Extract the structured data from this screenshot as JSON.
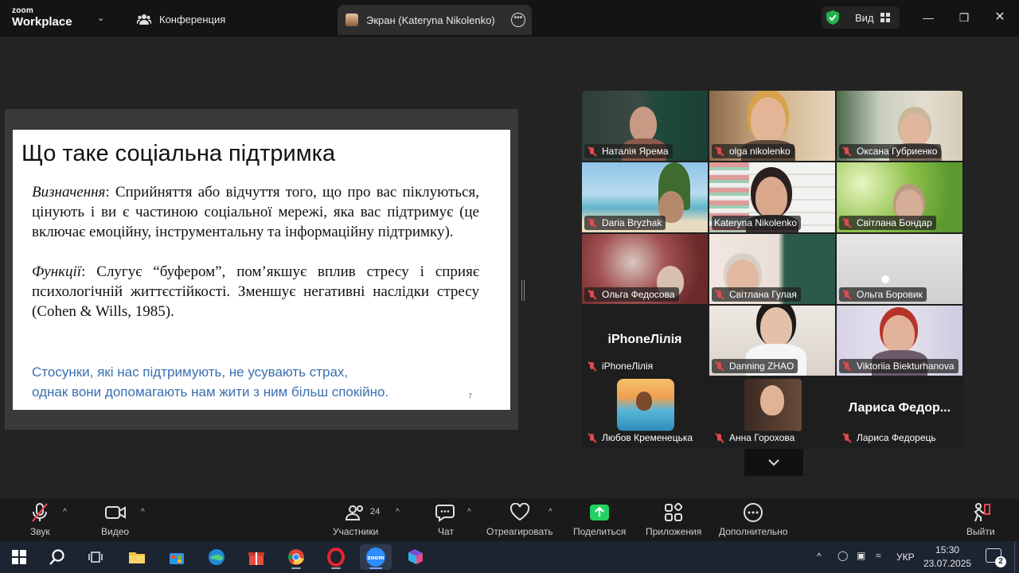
{
  "titlebar": {
    "logo_line1": "zoom",
    "logo_line2": "Workplace",
    "conference_tab": "Конференция",
    "screen_tab": "Экран (Kateryna Nikolenko)",
    "view_label": "Вид"
  },
  "slide": {
    "title": "Що таке соціальна підтримка",
    "definition_term": "Визначення",
    "definition_text": ": Сприйняття або відчуття того, що про вас піклуються, цінують і ви є частиною соціальної мережі, яка вас підтримує (це включає емоційну, інструментальну та інформаційну підтримку).",
    "functions_term": "Функції",
    "functions_text": ": Слугує “буфером”, пом’якшує вплив стресу і сприяє психологічній життєстійкості. Зменшує негативні наслідки стресу (Cohen & Wills, 1985).",
    "quote_line1": "Стосунки, які нас підтримують, не усувають страх,",
    "quote_line2": "однак вони допомагають нам жити з ним більш спокійно.",
    "page_number": "7"
  },
  "gallery": {
    "tiles": [
      {
        "name": "Наталія Ярема",
        "muted": true
      },
      {
        "name": "olga nikolenko",
        "muted": true
      },
      {
        "name": "Оксана Губриенко",
        "muted": true
      },
      {
        "name": "Daria Bryzhak",
        "muted": true
      },
      {
        "name": "Kateryna Nikolenko",
        "muted": false
      },
      {
        "name": "Світлана Бондар",
        "muted": true
      },
      {
        "name": "Ольга Федосова",
        "muted": true
      },
      {
        "name": "Світлана Гулая",
        "muted": true
      },
      {
        "name": "Ольга Боровик",
        "muted": true
      },
      {
        "name": "iPhoneЛілія",
        "muted": true,
        "display_text": "iPhoneЛілія"
      },
      {
        "name": "Danning ZHAO",
        "muted": true,
        "active_speaker": true
      },
      {
        "name": "Viktoriia Biekturhanova",
        "muted": true
      },
      {
        "name": "Любов Кременецька",
        "muted": true
      },
      {
        "name": "Анна Горохова",
        "muted": true
      },
      {
        "name": "Лариса Федорець",
        "muted": true,
        "display_text": "Лариса  Федор..."
      }
    ]
  },
  "toolbar": {
    "audio": "Звук",
    "video": "Видео",
    "participants": "Участники",
    "participants_count": "24",
    "chat": "Чат",
    "react": "Отреагировать",
    "share": "Поделиться",
    "apps": "Приложения",
    "more": "Дополнительно",
    "leave": "Выйти"
  },
  "taskbar": {
    "language": "УКР",
    "time": "15:30",
    "date": "23.07.2025",
    "notifications": "2"
  },
  "colors": {
    "accent_green": "#23d160",
    "mute_red": "#e5484d",
    "slide_quote_blue": "#3a6fb0"
  }
}
